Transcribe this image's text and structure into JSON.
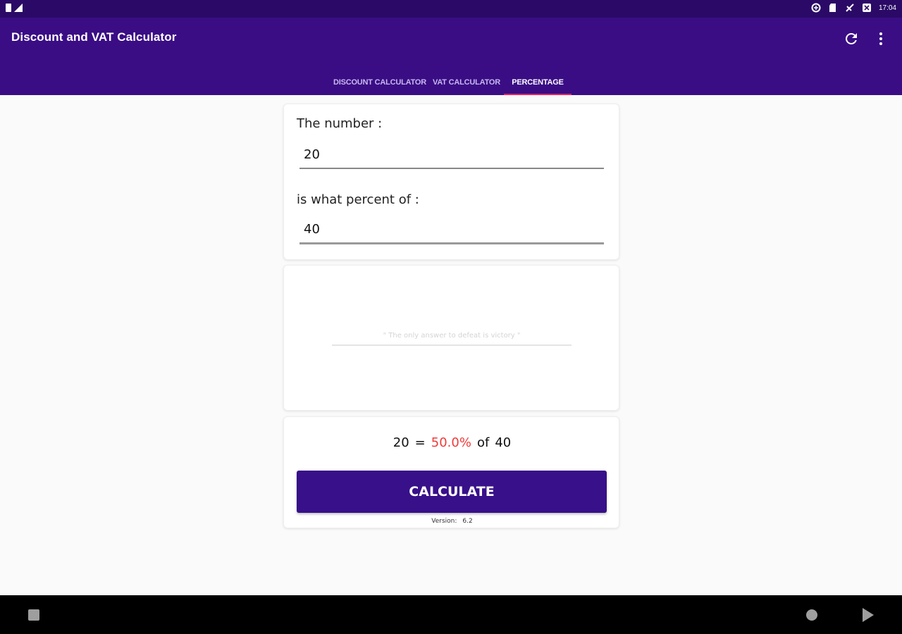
{
  "status_bar": {
    "time": "17:04",
    "icons": [
      "battery-icon",
      "signal-icon",
      "data-saver-icon",
      "sd-card-icon",
      "no-signal-icon",
      "notification-icon"
    ]
  },
  "app_bar": {
    "title": "Discount and VAT Calculator",
    "icons": [
      "refresh-icon",
      "more-vert-icon"
    ],
    "background_color": "#3a0d85"
  },
  "tabs": [
    {
      "label": "DISCOUNT CALCULATOR",
      "active": false
    },
    {
      "label": "VAT CALCULATOR",
      "active": false
    },
    {
      "label": "PERCENTAGE",
      "active": true
    }
  ],
  "tab_indicator_color": "#e91e63",
  "form": {
    "number_label": "The number :",
    "number_value": "20",
    "percent_of_label": "is what percent of :",
    "percent_of_value": "40"
  },
  "history": {
    "placeholder": "\" The only answer to defeat is victory \""
  },
  "result": {
    "number": "20",
    "equals": "=",
    "percent": "50.0%",
    "of": "of",
    "total": "40",
    "percent_color": "#f03a3a"
  },
  "calculate_button": {
    "label": "CALCULATE",
    "color": "#38108a"
  },
  "version": {
    "label": "Version:",
    "value": "6.2"
  },
  "nav_bar": {
    "icons": [
      "recents-square-icon",
      "home-circle-icon",
      "back-triangle-icon"
    ]
  }
}
